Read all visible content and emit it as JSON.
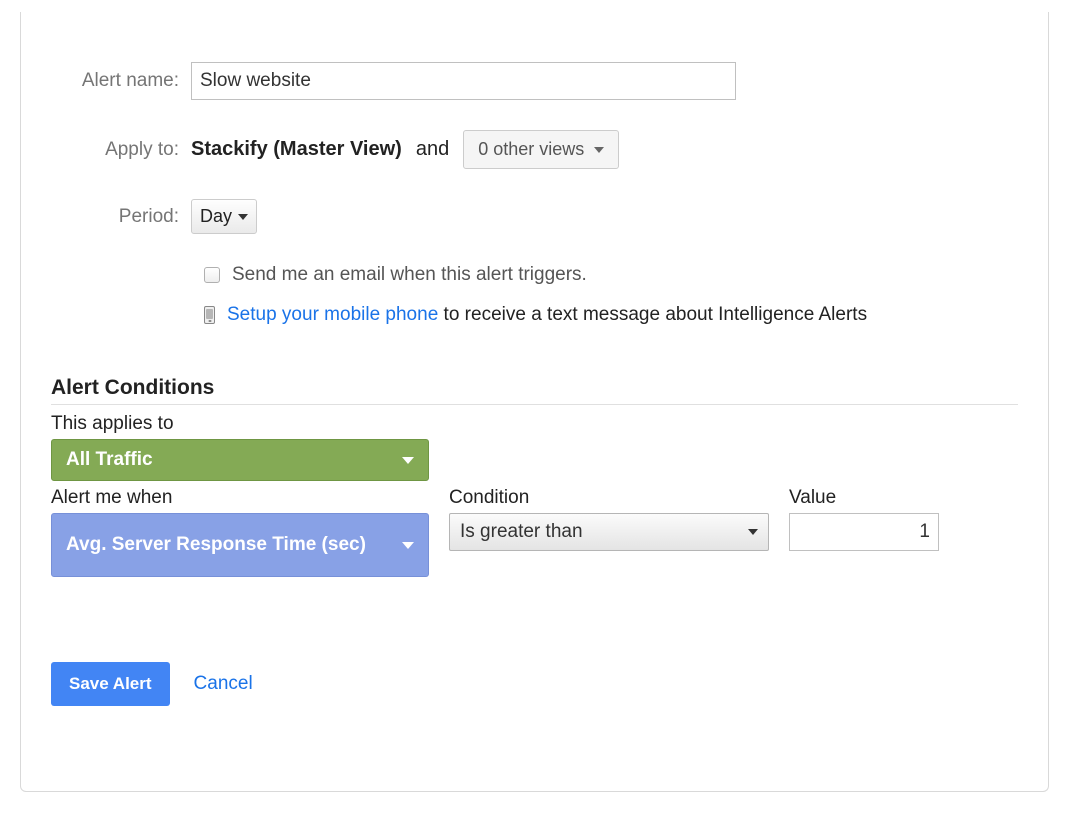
{
  "labels": {
    "alert_name": "Alert name:",
    "apply_to": "Apply to:",
    "period": "Period:"
  },
  "alert_name_value": "Slow website",
  "apply_to": {
    "view_name": "Stackify (Master View)",
    "and": "and",
    "other_views": "0 other views"
  },
  "period_value": "Day",
  "email_checkbox_label": "Send me an email when this alert triggers.",
  "mobile": {
    "link": "Setup your mobile phone",
    "suffix": " to receive a text message about Intelligence Alerts"
  },
  "conditions": {
    "title": "Alert Conditions",
    "applies_to_label": "This applies to",
    "applies_to_value": "All Traffic",
    "alert_when_label": "Alert me when",
    "alert_when_value": "Avg. Server Response Time (sec)",
    "condition_label": "Condition",
    "condition_value": "Is greater than",
    "value_label": "Value",
    "value_value": "1"
  },
  "actions": {
    "save": "Save Alert",
    "cancel": "Cancel"
  }
}
